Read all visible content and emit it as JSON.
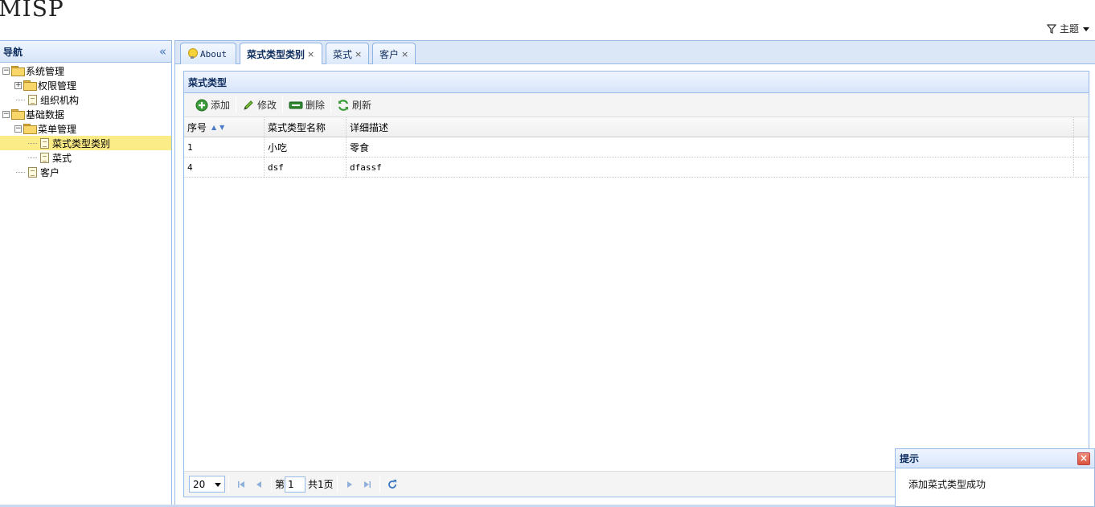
{
  "app": {
    "title": "MISP"
  },
  "theme_menu": {
    "label": "主题"
  },
  "nav": {
    "title": "导航",
    "collapse_icon": "«",
    "tree": [
      {
        "label": "系统管理",
        "level": 0,
        "type": "folder",
        "expander": "−"
      },
      {
        "label": "权限管理",
        "level": 1,
        "type": "folder",
        "expander": "+"
      },
      {
        "label": "组织机构",
        "level": 1,
        "type": "file"
      },
      {
        "label": "基础数据",
        "level": 0,
        "type": "folder",
        "expander": "−"
      },
      {
        "label": "菜单管理",
        "level": 1,
        "type": "folder",
        "expander": "−"
      },
      {
        "label": "菜式类型类别",
        "level": 2,
        "type": "file",
        "selected": true
      },
      {
        "label": "菜式",
        "level": 2,
        "type": "file"
      },
      {
        "label": "客户",
        "level": 1,
        "type": "file"
      }
    ]
  },
  "tabs": [
    {
      "label": "About",
      "icon": "bulb-icon",
      "closable": false
    },
    {
      "label": "菜式类型类别",
      "closable": true,
      "active": true
    },
    {
      "label": "菜式",
      "closable": true
    },
    {
      "label": "客户",
      "closable": true
    }
  ],
  "tab_close_glyph": "×",
  "panel": {
    "title": "菜式类型"
  },
  "toolbar": {
    "add_label": "添加",
    "edit_label": "修改",
    "delete_label": "删除",
    "refresh_label": "刷新"
  },
  "grid": {
    "columns": [
      "序号",
      "菜式类型名称",
      "详细描述"
    ],
    "rows": [
      [
        "1",
        "小吃",
        "零食"
      ],
      [
        "4",
        "dsf",
        "dfassf"
      ]
    ]
  },
  "pager": {
    "page_size": "20",
    "page_prefix": "第",
    "page_value": "1",
    "total_pages": "共1页"
  },
  "toast": {
    "title": "提示",
    "close_glyph": "×",
    "message": "添加菜式类型成功"
  },
  "colors": {
    "header_gradient_top": "#eff5ff",
    "header_gradient_bottom": "#d7e5f9",
    "border": "#99bbe8",
    "selected_row": "#fbec88",
    "title_text": "#0e2d5f"
  }
}
